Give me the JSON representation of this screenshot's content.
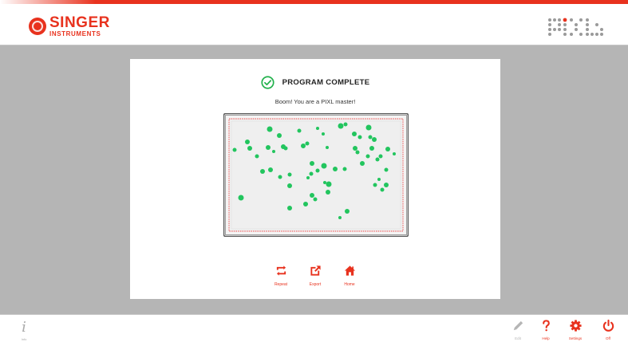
{
  "header": {
    "brand_line1": "SINGER",
    "brand_line2": "INSTRUMENTS",
    "accent_color": "#e8321e"
  },
  "result": {
    "title": "PROGRAM COMPLETE",
    "subtitle": "Boom! You are a PIXL master!",
    "status_icon": "check-circle-icon",
    "success_color": "#22c55e"
  },
  "actions": [
    {
      "label": "Repeat",
      "icon": "repeat-icon"
    },
    {
      "label": "Export",
      "icon": "export-icon"
    },
    {
      "label": "Home",
      "icon": "home-icon"
    }
  ],
  "footer": {
    "info_label": "Info",
    "edit_label": "Edit",
    "help_label": "Help",
    "settings_label": "Settings",
    "off_label": "Off"
  },
  "plate": {
    "colonies": [
      [
        338,
        162,
        3.5
      ],
      [
        336,
        185,
        3
      ],
      [
        350,
        170,
        3
      ],
      [
        375,
        164,
        2.5
      ],
      [
        398,
        161,
        2
      ],
      [
        405,
        168,
        2
      ],
      [
        427,
        158,
        3.5
      ],
      [
        433,
        156,
        2.5
      ],
      [
        444,
        168,
        3
      ],
      [
        451,
        172,
        2.5
      ],
      [
        462,
        160,
        3.5
      ],
      [
        464,
        172,
        2.5
      ],
      [
        469,
        175,
        3
      ],
      [
        486,
        187,
        3
      ],
      [
        477,
        196,
        2.5
      ],
      [
        494,
        193,
        2
      ],
      [
        294,
        188,
        2.5
      ],
      [
        310,
        178,
        3
      ],
      [
        313,
        186,
        3
      ],
      [
        322,
        196,
        2.5
      ],
      [
        343,
        190,
        2
      ],
      [
        355,
        184,
        3
      ],
      [
        358,
        186,
        2.5
      ],
      [
        380,
        183,
        3
      ],
      [
        385,
        180,
        2.5
      ],
      [
        410,
        185,
        2
      ],
      [
        445,
        186,
        3
      ],
      [
        448,
        191,
        2.5
      ],
      [
        454,
        205,
        3
      ],
      [
        461,
        196,
        2.5
      ],
      [
        466,
        186,
        3
      ],
      [
        473,
        200,
        2.5
      ],
      [
        484,
        213,
        2.5
      ],
      [
        475,
        225,
        2
      ],
      [
        470,
        232,
        2.5
      ],
      [
        484,
        232,
        3
      ],
      [
        479,
        238,
        2.5
      ],
      [
        420,
        212,
        3
      ],
      [
        432,
        212,
        2.5
      ],
      [
        406,
        208,
        3.5
      ],
      [
        398,
        214,
        2.5
      ],
      [
        391,
        205,
        3
      ],
      [
        390,
        218,
        2.5
      ],
      [
        386,
        223,
        2
      ],
      [
        363,
        219,
        2.5
      ],
      [
        329,
        215,
        3
      ],
      [
        339,
        213,
        3
      ],
      [
        351,
        222,
        2.5
      ],
      [
        363,
        233,
        3
      ],
      [
        412,
        231,
        3.5
      ],
      [
        411,
        241,
        3
      ],
      [
        407,
        229,
        2
      ],
      [
        391,
        245,
        3
      ],
      [
        383,
        256,
        3
      ],
      [
        395,
        250,
        2.5
      ],
      [
        363,
        261,
        3
      ],
      [
        302,
        248,
        3.5
      ],
      [
        435,
        265,
        3
      ],
      [
        426,
        273,
        2
      ]
    ]
  }
}
